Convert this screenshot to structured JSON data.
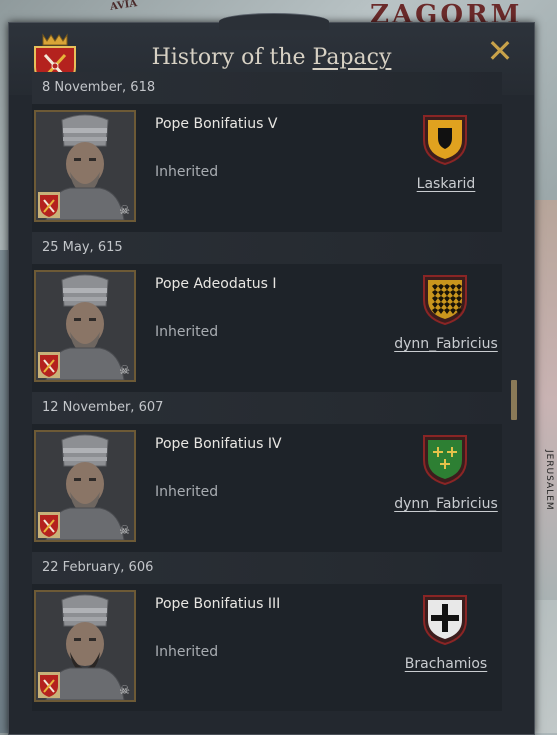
{
  "window": {
    "title_prefix": "History of the",
    "title_link": "Papacy",
    "close_label": "✕"
  },
  "map": {
    "label_top_right": "ZAGORM",
    "label_top_left": "AVIA",
    "label_right_edge": "JERUSALEM"
  },
  "entries": [
    {
      "date": "8 November, 618",
      "name": "Pope Bonifatius V",
      "status": "Inherited",
      "house": "Laskarid",
      "emblem": "shield-black-on-gold-icon",
      "emblem_color": "#e0a21f"
    },
    {
      "date": "25 May, 615",
      "name": "Pope Adeodatus I",
      "status": "Inherited",
      "house": "dynn_Fabricius",
      "emblem": "checky-gold-black-icon",
      "emblem_color": "#c9961d"
    },
    {
      "date": "12 November, 607",
      "name": "Pope Bonifatius IV",
      "status": "Inherited",
      "house": "dynn_Fabricius",
      "emblem": "crosses-gold-on-green-icon",
      "emblem_color": "#2d7f33"
    },
    {
      "date": "22 February, 606",
      "name": "Pope Bonifatius III",
      "status": "Inherited",
      "house": "Brachamios",
      "emblem": "cross-black-on-white-icon",
      "emblem_color": "#e8e8e8"
    }
  ]
}
